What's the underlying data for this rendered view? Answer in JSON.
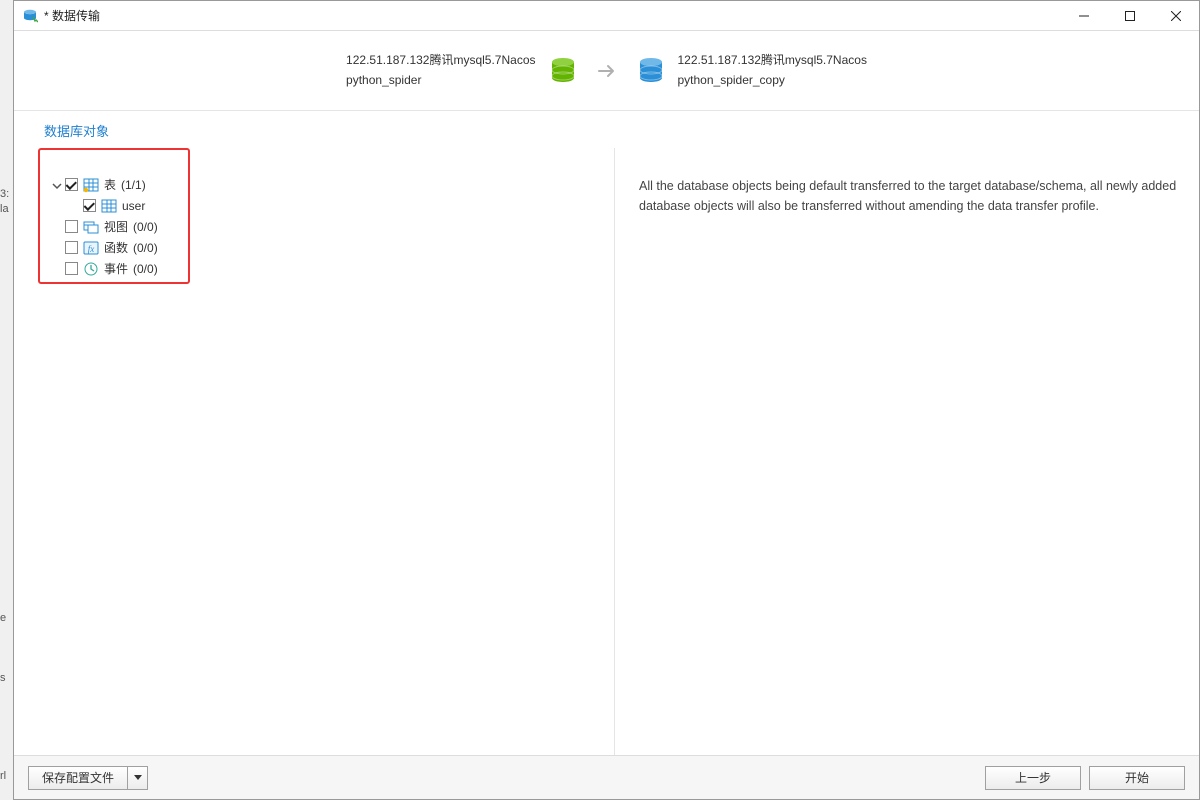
{
  "window": {
    "title": "* 数据传输"
  },
  "connection": {
    "source": {
      "server": "122.51.187.132腾讯mysql5.7Nacos",
      "database": "python_spider",
      "color": "#63b400"
    },
    "target": {
      "server": "122.51.187.132腾讯mysql5.7Nacos",
      "database": "python_spider_copy",
      "color": "#2a8fd6"
    }
  },
  "section": {
    "title": "数据库对象"
  },
  "tree": {
    "tables": {
      "label": "表",
      "count": "(1/1)",
      "checked": true,
      "expanded": true,
      "children": [
        {
          "label": "user",
          "checked": true
        }
      ]
    },
    "views": {
      "label": "视图",
      "count": "(0/0)",
      "checked": false
    },
    "functions": {
      "label": "函数",
      "count": "(0/0)",
      "checked": false
    },
    "events": {
      "label": "事件",
      "count": "(0/0)",
      "checked": false
    }
  },
  "info_text": "All the database objects being default transferred to the target database/schema, all newly added database objects will also be transferred without amending the data transfer profile.",
  "footer": {
    "save_profile": "保存配置文件",
    "prev": "上一步",
    "start": "开始"
  },
  "edge_fragments": {
    "a": "3:",
    "b": "la",
    "c": "e",
    "d": "s",
    "e": "rl"
  }
}
